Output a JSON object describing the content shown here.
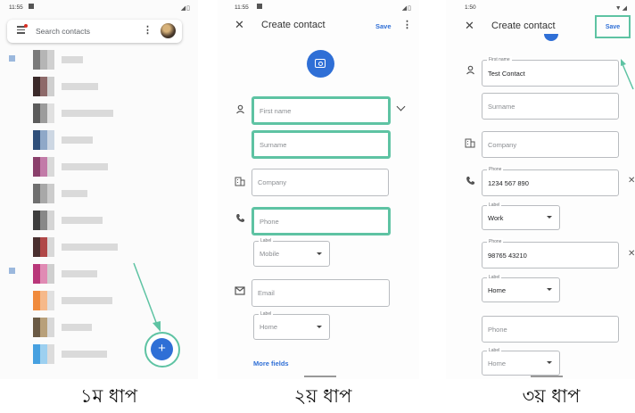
{
  "step1": {
    "time": "11:55",
    "search_placeholder": "Search contacts",
    "fab_label": "+",
    "caption": "১ম ধাপ"
  },
  "step2": {
    "time": "11:55",
    "title": "Create contact",
    "save_label": "Save",
    "fields": {
      "first_name": "First name",
      "surname": "Surname",
      "company": "Company",
      "phone": "Phone",
      "email": "Email"
    },
    "phone_label": {
      "label": "Label",
      "value": "Mobile"
    },
    "email_label": {
      "label": "Label",
      "value": "Home"
    },
    "more_fields": "More fields",
    "caption": "২য় ধাপ"
  },
  "step3": {
    "time": "1:50",
    "title": "Create contact",
    "save_label": "Save",
    "first_name": {
      "label": "First name",
      "value": "Test Contact"
    },
    "surname_placeholder": "Surname",
    "company_placeholder": "Company",
    "phone1": {
      "label": "Phone",
      "value": "1234 567 890"
    },
    "phone1_label": {
      "label": "Label",
      "value": "Work"
    },
    "phone2": {
      "label": "Phone",
      "value": "98765 43210"
    },
    "phone2_label": {
      "label": "Label",
      "value": "Home"
    },
    "phone3_placeholder": "Phone",
    "phone3_label": {
      "label": "Label",
      "value": "Home"
    },
    "caption": "৩য় ধাপ"
  },
  "colors": {
    "accent_blue": "#2f6fd6",
    "highlight_green": "#5ec3a3"
  }
}
